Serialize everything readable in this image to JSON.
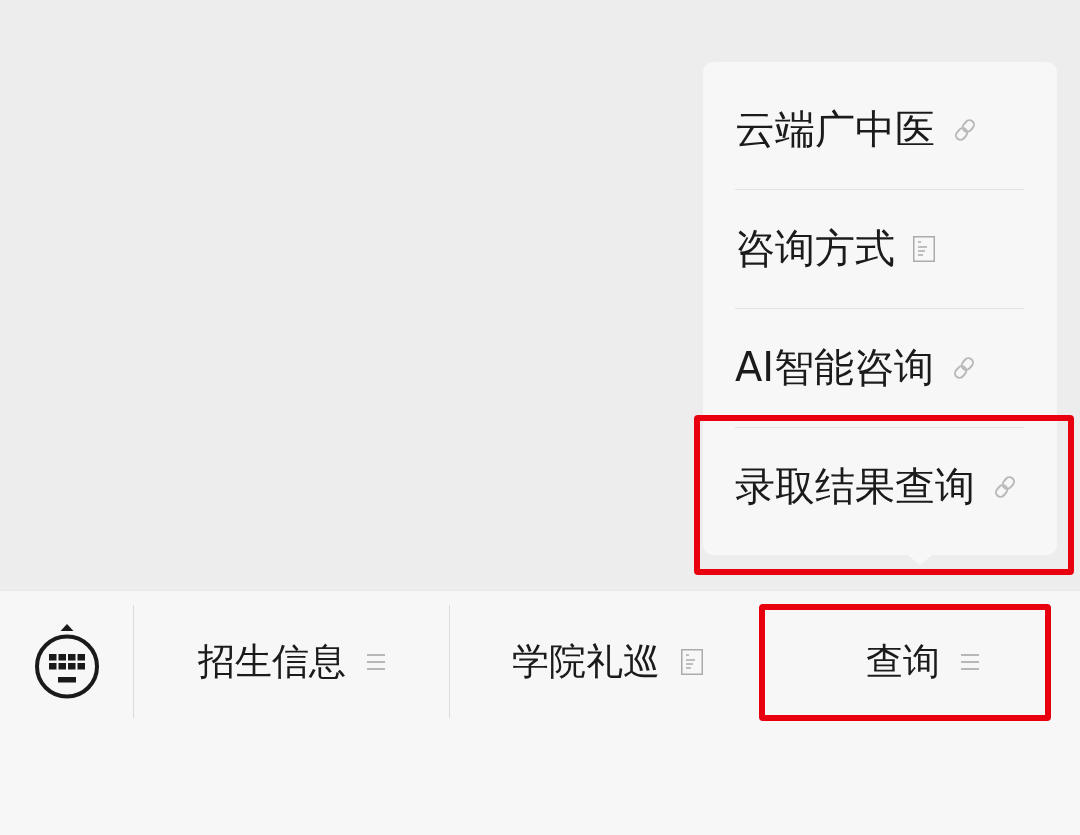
{
  "tab_bar": {
    "tabs": [
      {
        "label": "招生信息",
        "kind": "submenu",
        "highlighted": false
      },
      {
        "label": "学院礼巡",
        "kind": "article",
        "highlighted": false
      },
      {
        "label": "查询",
        "kind": "submenu",
        "highlighted": true,
        "submenu": [
          {
            "label": "云端广中医",
            "kind": "link",
            "highlighted": false
          },
          {
            "label": "咨询方式",
            "kind": "article",
            "highlighted": false
          },
          {
            "label": "AI智能咨询",
            "kind": "link",
            "highlighted": false
          },
          {
            "label": "录取结果查询",
            "kind": "link",
            "highlighted": true
          }
        ]
      }
    ]
  }
}
